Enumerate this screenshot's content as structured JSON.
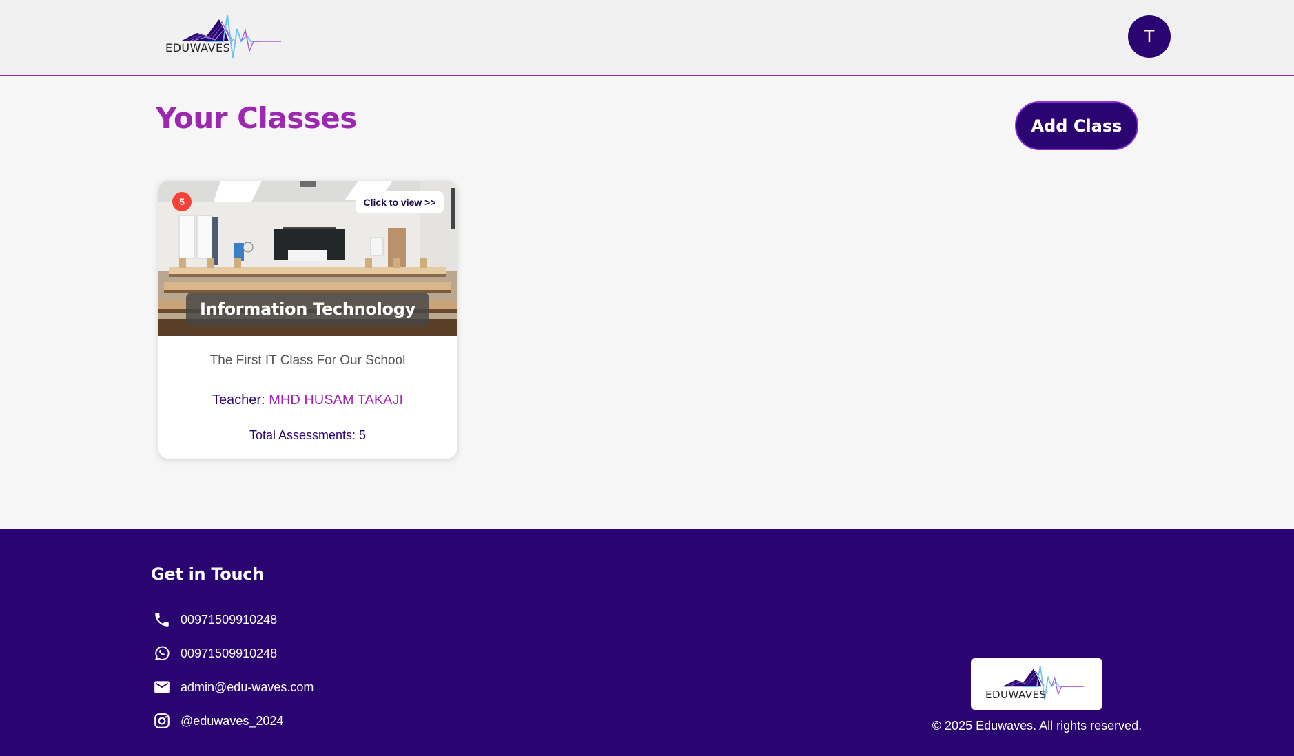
{
  "header": {
    "logo_text": "EDUWAVES",
    "avatar_initial": "T"
  },
  "main": {
    "title": "Your Classes",
    "add_class_label": "Add Class",
    "classes": [
      {
        "badge_count": "5",
        "view_label": "Click to view >>",
        "name": "Information Technology",
        "description": "The First IT Class For Our School",
        "teacher_label": "Teacher:",
        "teacher_name": "MHD HUSAM TAKAJI",
        "total_assessments": "Total Assessments: 5"
      }
    ]
  },
  "footer": {
    "heading": "Get in Touch",
    "contacts": [
      {
        "icon": "phone-icon",
        "text": "00971509910248"
      },
      {
        "icon": "whatsapp-icon",
        "text": "00971509910248"
      },
      {
        "icon": "email-icon",
        "text": "admin@edu-waves.com"
      },
      {
        "icon": "instagram-icon",
        "text": "@eduwaves_2024"
      }
    ],
    "logo_text": "EDUWAVES",
    "copyright": "© 2025 Eduwaves. All rights reserved."
  },
  "colors": {
    "primary": "#2a0572",
    "accent": "#9c27b0",
    "badge": "#f44336",
    "header_bg": "#f1f1f1",
    "page_bg": "#f6f6f6"
  }
}
